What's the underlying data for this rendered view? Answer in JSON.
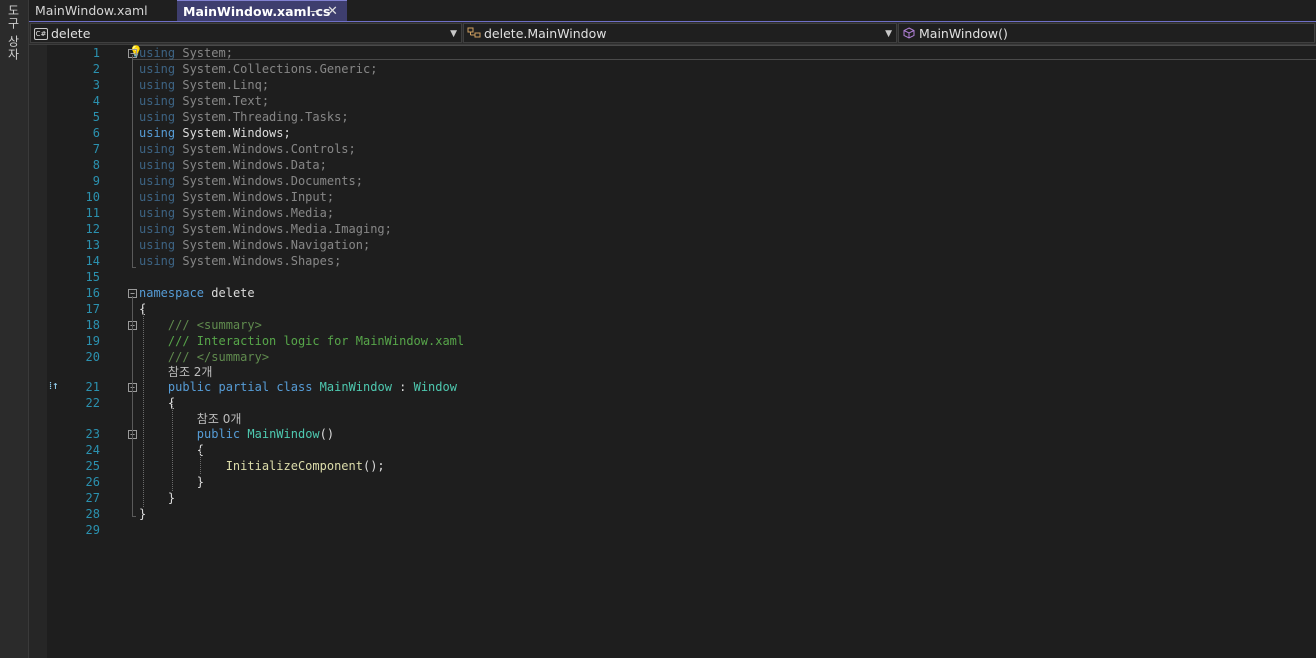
{
  "toolbox": {
    "label": "도구 상자"
  },
  "tabs": [
    {
      "label": "MainWindow.xaml",
      "active": false
    },
    {
      "label": "MainWindow.xaml.cs",
      "active": true
    }
  ],
  "tab_icons": {
    "pin": "⊸",
    "close": "✕"
  },
  "nav": {
    "project": "delete",
    "project_icon": "C#",
    "class": "delete.MainWindow",
    "member": "MainWindow()"
  },
  "code": {
    "usings": [
      "System",
      "System.Collections.Generic",
      "System.Linq",
      "System.Text",
      "System.Threading.Tasks",
      "System.Windows",
      "System.Windows.Controls",
      "System.Windows.Data",
      "System.Windows.Documents",
      "System.Windows.Input",
      "System.Windows.Media",
      "System.Windows.Media.Imaging",
      "System.Windows.Navigation",
      "System.Windows.Shapes"
    ],
    "kw_using": "using",
    "kw_namespace": "namespace",
    "namespace_name": "delete",
    "summary_open": "/// <summary>",
    "summary_text": "/// Interaction logic for MainWindow.xaml",
    "summary_close": "/// </summary>",
    "refs_class": "참조 2개",
    "kw_public": "public",
    "kw_partial": "partial",
    "kw_class": "class",
    "class_name": "MainWindow",
    "base_type": "Window",
    "refs_ctor": "참조 0개",
    "ctor_name": "MainWindow",
    "call": "InitializeComponent",
    "line_numbers": [
      "1",
      "2",
      "3",
      "4",
      "5",
      "6",
      "7",
      "8",
      "9",
      "10",
      "11",
      "12",
      "13",
      "14",
      "15",
      "16",
      "17",
      "18",
      "19",
      "20",
      "21",
      "22",
      "23",
      "24",
      "25",
      "26",
      "27",
      "28",
      "29"
    ]
  },
  "colors": {
    "keyword": "#569cd6",
    "type": "#4ec9b0",
    "comment": "#57a64a",
    "method": "#dcdcaa",
    "line_number": "#2b91af",
    "active_tab": "#3e3e6e"
  }
}
